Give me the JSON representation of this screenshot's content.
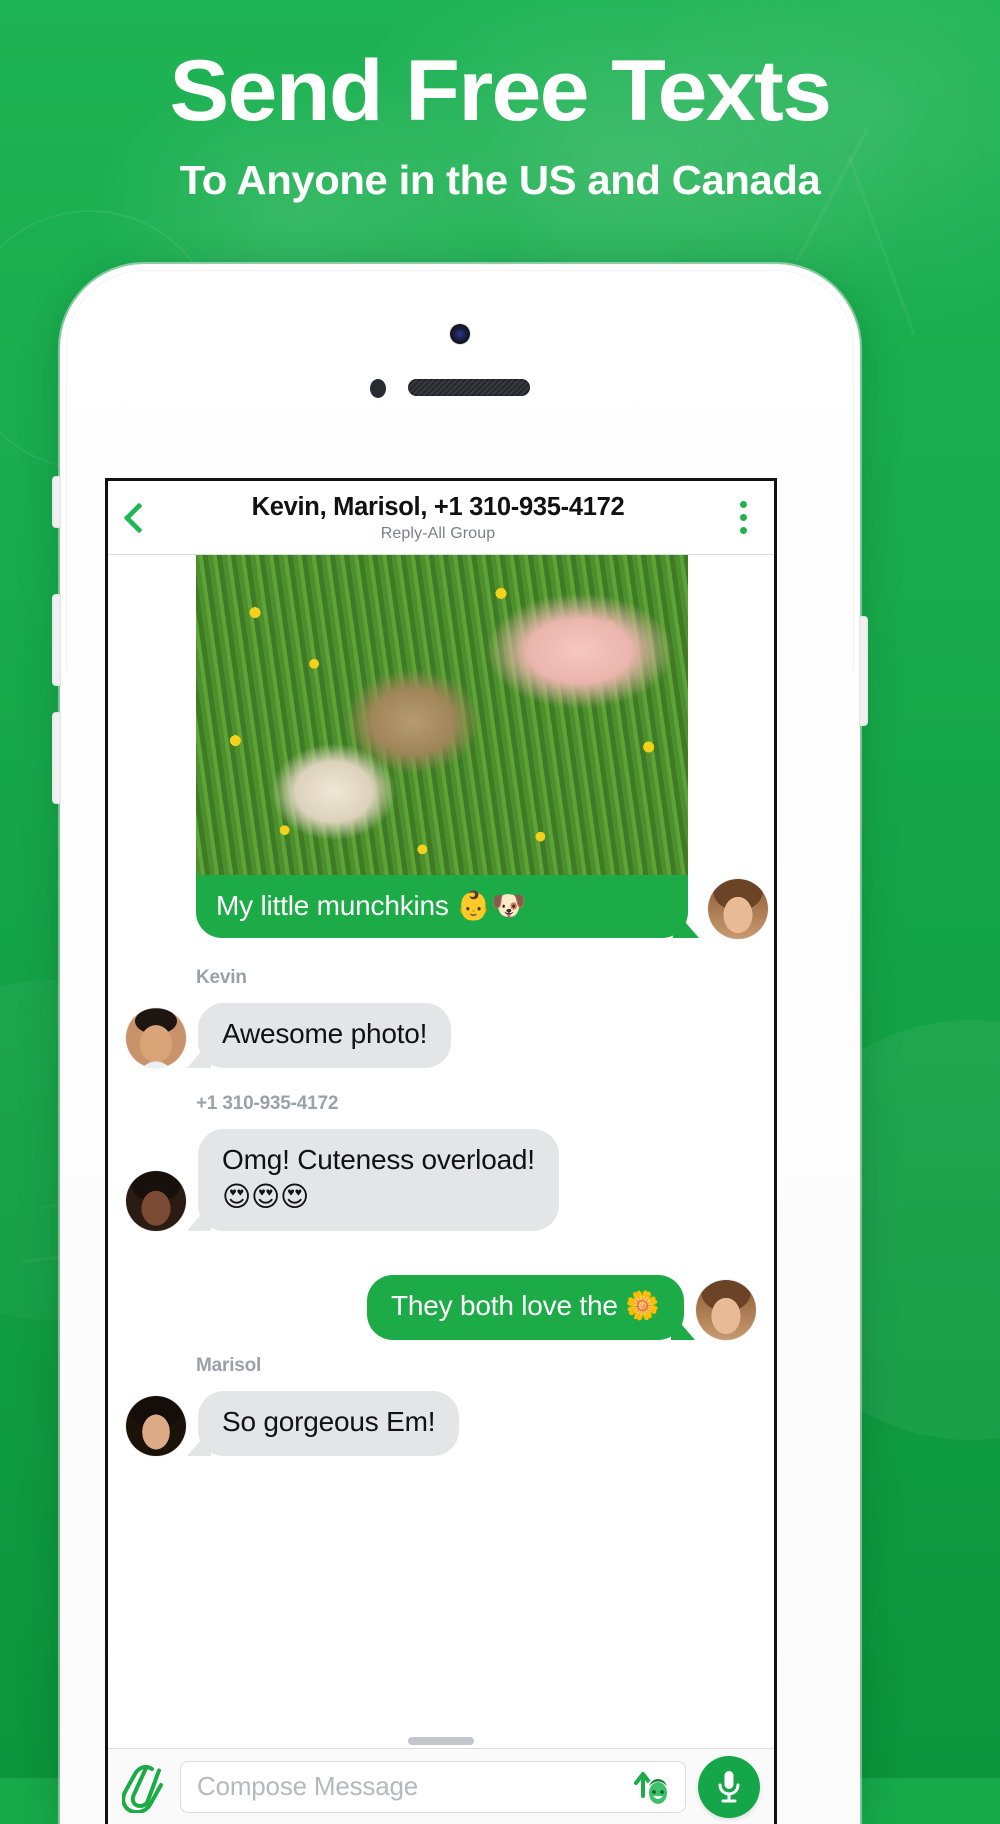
{
  "promo": {
    "headline": "Send Free Texts",
    "subhead": "To Anyone in the US and Canada"
  },
  "colors": {
    "brand_green": "#17a94a",
    "bubble_out": "#1cab47",
    "bubble_in": "#e4e5e7",
    "accent_icon": "#21b24b",
    "name_label": "#9aa1a8"
  },
  "chat_header": {
    "back_icon": "back-chevron-icon",
    "title": "Kevin, Marisol, +1 310-935-4172",
    "subtitle": "Reply-All Group",
    "menu_icon": "kebab-menu-icon"
  },
  "messages": [
    {
      "id": "m1",
      "direction": "out",
      "type": "photo",
      "caption": "My little munchkins ",
      "caption_emoji": "👶🐶",
      "avatar": "avatar-em"
    },
    {
      "id": "m2",
      "direction": "in",
      "sender": "Kevin",
      "text": "Awesome photo!",
      "avatar": "avatar-kevin"
    },
    {
      "id": "m3",
      "direction": "in",
      "sender": "+1 310-935-4172",
      "text": "Omg! Cuteness overload!",
      "text_emoji": "😍😍😍",
      "avatar": "avatar-unknown"
    },
    {
      "id": "m4",
      "direction": "out",
      "text": "They both love the ",
      "text_emoji": "🌼",
      "avatar": "avatar-em"
    },
    {
      "id": "m5",
      "direction": "in",
      "sender": "Marisol",
      "text": "So gorgeous Em!",
      "avatar": "avatar-marisol"
    }
  ],
  "compose": {
    "attach_icon": "paperclip-icon",
    "placeholder": "Compose Message",
    "value": "",
    "send_icon": "send-up-arrow-icon",
    "mic_icon": "microphone-icon"
  }
}
